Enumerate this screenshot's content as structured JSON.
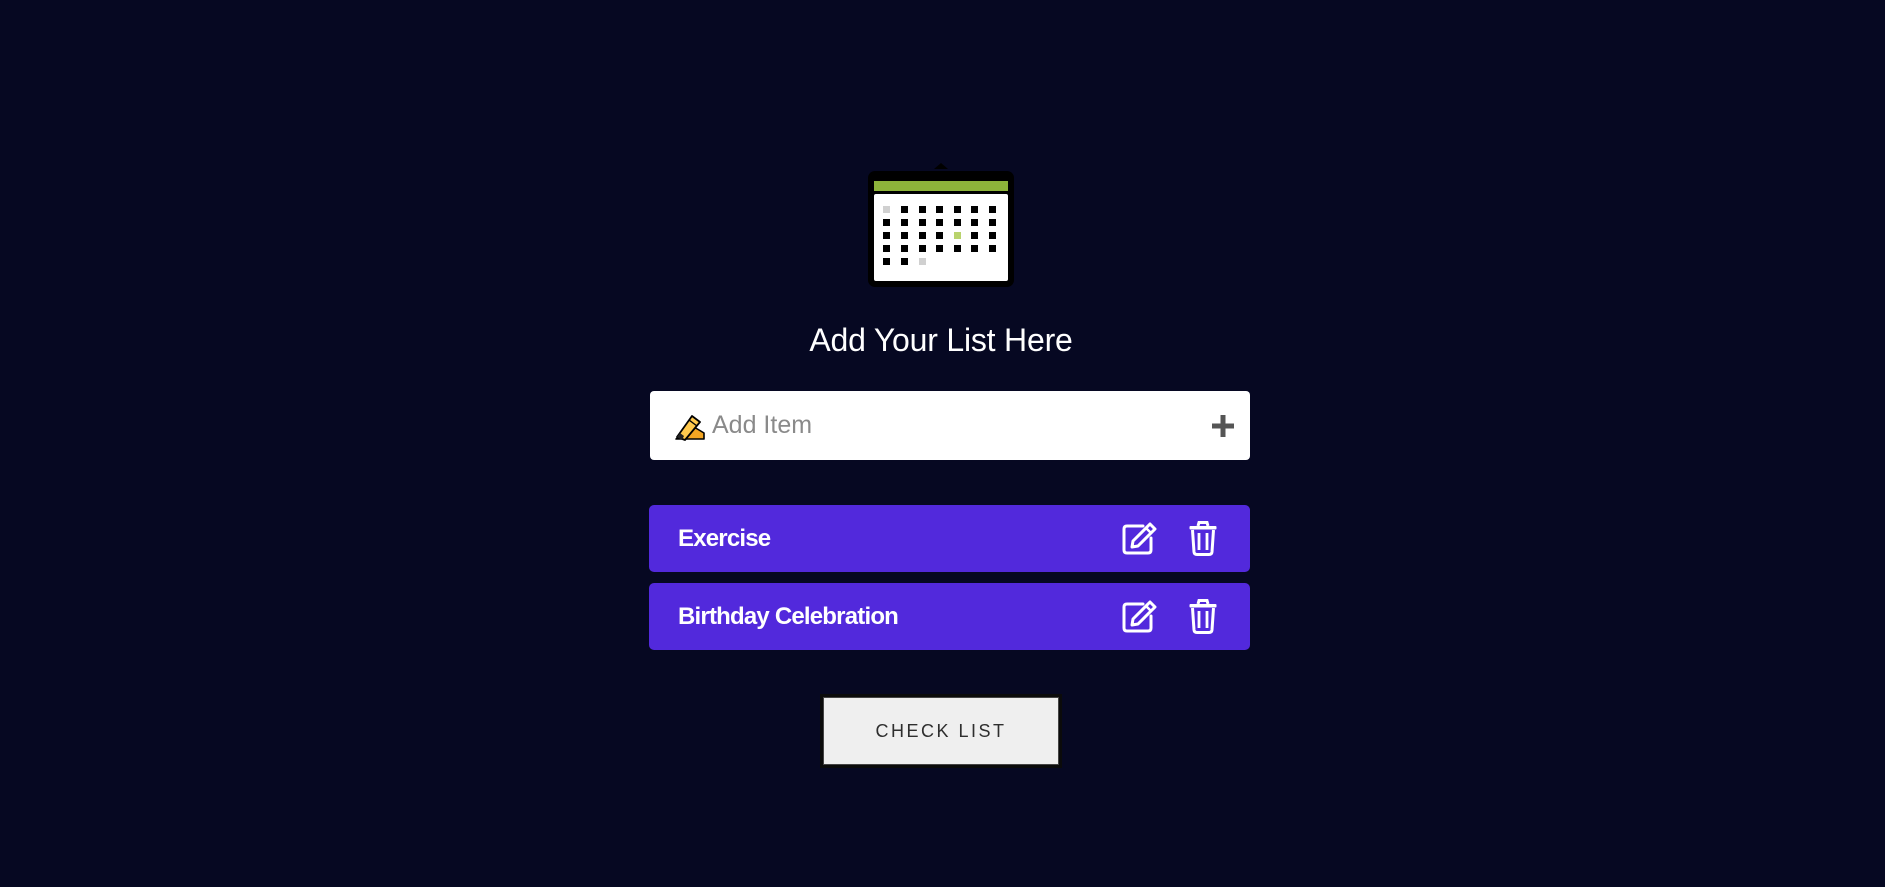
{
  "header": {
    "logo_icon": "calendar-icon",
    "title": "Add Your List Here"
  },
  "input": {
    "icon": "pencil-icon",
    "placeholder": "Add Item",
    "value": "",
    "add_icon": "plus-icon"
  },
  "items": [
    {
      "label": "Exercise",
      "edit_icon": "edit-icon",
      "delete_icon": "trash-icon"
    },
    {
      "label": "Birthday Celebration",
      "edit_icon": "edit-icon",
      "delete_icon": "trash-icon"
    }
  ],
  "actions": {
    "check_list_label": "CHECK LIST"
  },
  "colors": {
    "background": "#060822",
    "item_background": "#5229dc",
    "calendar_header": "#8db33a"
  }
}
